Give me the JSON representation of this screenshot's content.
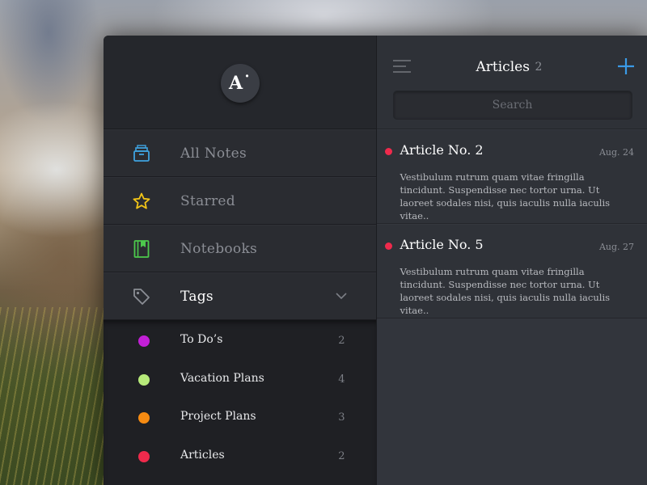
{
  "app": {
    "logo_text": "A˙"
  },
  "sidebar": {
    "items": [
      {
        "label": "All Notes",
        "icon": "archive-box-icon",
        "color": "#3fa3e0"
      },
      {
        "label": "Starred",
        "icon": "star-icon",
        "color": "#f2c417"
      },
      {
        "label": "Notebooks",
        "icon": "notebook-icon",
        "color": "#4cc94c"
      },
      {
        "label": "Tags",
        "icon": "tag-icon",
        "color": "#8b8e95",
        "active": true,
        "expanded": true
      }
    ],
    "tags": [
      {
        "label": "To Do’s",
        "count": "2",
        "color": "#c21fd6"
      },
      {
        "label": "Vacation Plans",
        "count": "4",
        "color": "#b7ea7a"
      },
      {
        "label": "Project Plans",
        "count": "3",
        "color": "#f68b12"
      },
      {
        "label": "Articles",
        "count": "2",
        "color": "#ef2a4c"
      }
    ]
  },
  "main": {
    "title": "Articles",
    "count": "2",
    "search_placeholder": "Search",
    "accent_color": "#3a9ae6",
    "articles": [
      {
        "title": "Article No. 2",
        "date": "Aug. 24",
        "excerpt": "Vestibulum rutrum quam vitae fringilla tincidunt. Suspendisse nec tortor urna. Ut laoreet sodales nisi, quis iaculis nulla iaculis vitae..",
        "dot_color": "#ef2a4c"
      },
      {
        "title": "Article No. 5",
        "date": "Aug. 27",
        "excerpt": "Vestibulum rutrum quam vitae fringilla tincidunt. Suspendisse nec tortor urna. Ut laoreet sodales nisi, quis iaculis nulla iaculis vitae..",
        "dot_color": "#ef2a4c"
      }
    ]
  }
}
